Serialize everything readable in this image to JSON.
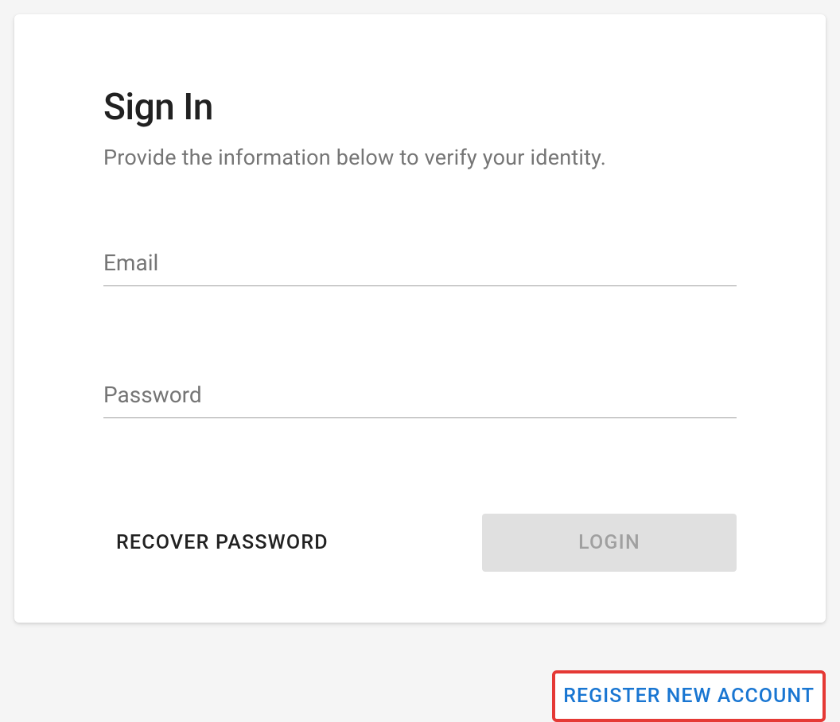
{
  "card": {
    "title": "Sign In",
    "subtitle": "Provide the information below to verify your identity.",
    "fields": {
      "email": {
        "label": "Email"
      },
      "password": {
        "label": "Password"
      }
    },
    "actions": {
      "recover": "RECOVER PASSWORD",
      "login": "LOGIN"
    }
  },
  "register": {
    "label": "REGISTER NEW ACCOUNT"
  }
}
